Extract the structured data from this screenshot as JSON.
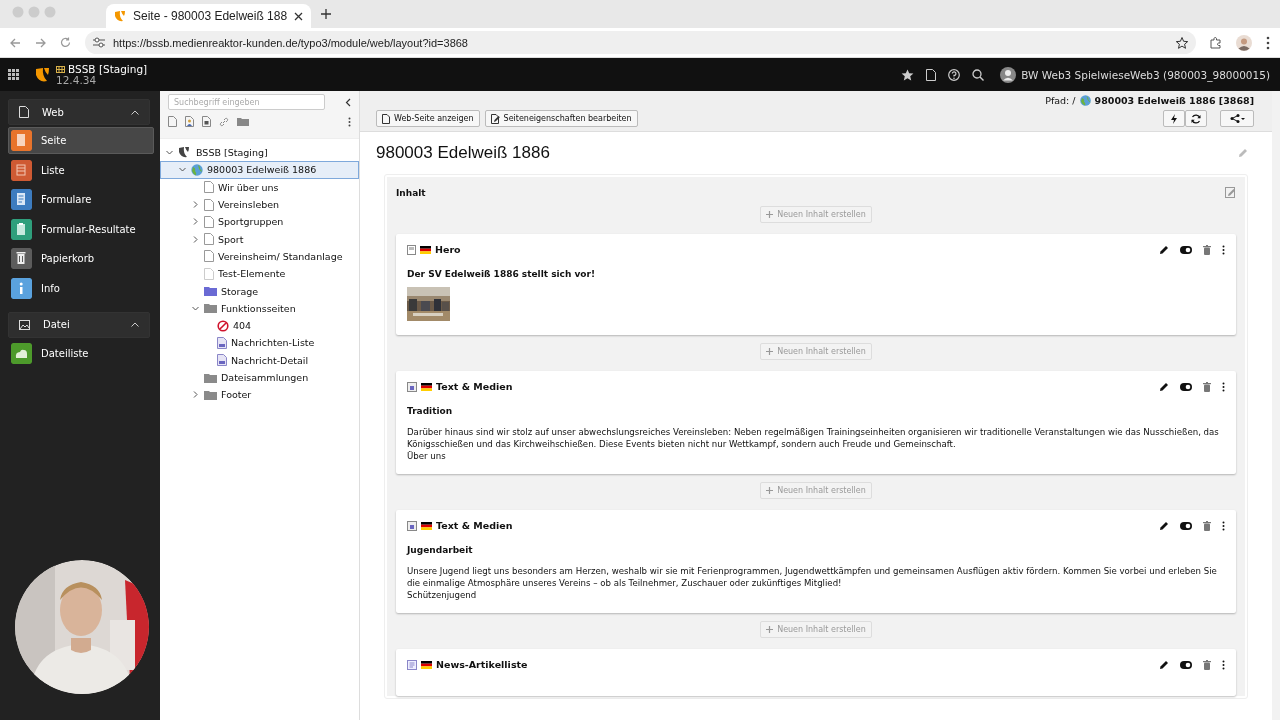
{
  "browser": {
    "tab_title": "Seite - 980003 Edelweiß 188",
    "url": "https://bssb.medienreaktor-kunden.de/typo3/module/web/layout?id=3868"
  },
  "topbar": {
    "site_name": "BSSB [Staging]",
    "version": "12.4.34",
    "user": "BW Web3 SpielwieseWeb3 (980003_98000015)"
  },
  "modules": [
    {
      "label": "Web",
      "expanded": true,
      "items": [
        {
          "label": "Seite",
          "color": "#e8742c",
          "selected": true
        },
        {
          "label": "Liste",
          "color": "#cf5a33",
          "selected": false
        },
        {
          "label": "Formulare",
          "color": "#3d7cbf",
          "selected": false
        },
        {
          "label": "Formular-Resultate",
          "color": "#2f9f7c",
          "selected": false
        },
        {
          "label": "Papierkorb",
          "color": "#5c5c5c",
          "selected": false
        },
        {
          "label": "Info",
          "color": "#5aa2de",
          "selected": false
        }
      ]
    },
    {
      "label": "Datei",
      "expanded": true,
      "items": [
        {
          "label": "Dateiliste",
          "color": "#4d9a2b",
          "selected": false
        }
      ]
    }
  ],
  "page_tree": {
    "search": {
      "placeholder": "Suchbegriff eingeben"
    },
    "nodes": [
      {
        "label": "BSSB [Staging]",
        "kind": "root",
        "expanded": true,
        "selected": false,
        "children": [
          {
            "label": "980003 Edelweiß 1886",
            "kind": "site",
            "expanded": true,
            "selected": true,
            "children": [
              {
                "label": "Wir über uns",
                "kind": "page",
                "selected": false
              },
              {
                "label": "Vereinsleben",
                "kind": "page",
                "expanded": false,
                "selected": false
              },
              {
                "label": "Sportgruppen",
                "kind": "page",
                "expanded": false,
                "selected": false
              },
              {
                "label": "Sport",
                "kind": "page",
                "expanded": false,
                "selected": false
              },
              {
                "label": "Vereinsheim/ Standanlage",
                "kind": "page",
                "selected": false
              },
              {
                "label": "Test-Elemente",
                "kind": "page_hidden",
                "selected": false
              },
              {
                "label": "Storage",
                "kind": "storage",
                "selected": false
              },
              {
                "label": "Funktionsseiten",
                "kind": "folder",
                "expanded": true,
                "selected": false,
                "children": [
                  {
                    "label": "404",
                    "kind": "error",
                    "selected": false
                  },
                  {
                    "label": "Nachrichten-Liste",
                    "kind": "plugin",
                    "selected": false
                  },
                  {
                    "label": "Nachricht-Detail",
                    "kind": "plugin",
                    "selected": false
                  }
                ]
              },
              {
                "label": "Dateisammlungen",
                "kind": "folder",
                "selected": false
              },
              {
                "label": "Footer",
                "kind": "folder",
                "expanded": false,
                "selected": false
              }
            ]
          }
        ]
      }
    ]
  },
  "doc_header": {
    "path_label": "Pfad: /",
    "path_title": "980003 Edelweiß 1886 [3868]",
    "buttons": [
      "Web-Seite anzeigen",
      "Seiteneigenschaften bearbeiten"
    ]
  },
  "page_title": "980003 Edelweiß 1886",
  "column": {
    "title": "Inhalt",
    "elements": [
      {
        "add_label": "Neuen Inhalt erstellen",
        "kind": "hero",
        "type_label": "Hero",
        "header": "Der SV Edelweiß 1886 stellt sich vor!"
      },
      {
        "add_label": "Neuen Inhalt erstellen",
        "kind": "textmedia",
        "type_label": "Text & Medien",
        "header": "Tradition",
        "bodytext": "Darüber hinaus sind wir stolz auf unser abwechslungsreiches Vereinsleben: Neben regelmäßigen Trainingseinheiten organisieren wir traditionelle Veranstaltungen wie das Nusschießen, das Königsschießen und das Kirchweihschießen. Diese Events bieten nicht nur Wettkampf, sondern auch Freude und Gemeinschaft.",
        "note": "Über uns"
      },
      {
        "add_label": "Neuen Inhalt erstellen",
        "kind": "textmedia",
        "type_label": "Text & Medien",
        "header": "Jugendarbeit",
        "bodytext": "Unsere Jugend liegt uns besonders am Herzen, weshalb wir sie mit Ferienprogrammen, Jugendwettkämpfen und gemeinsamen Ausflügen aktiv fördern. Kommen Sie vorbei und erleben Sie die einmalige Atmosphäre unseres Vereins – ob als Teilnehmer, Zuschauer oder zukünftiges Mitglied!",
        "note": "Schützenjugend"
      },
      {
        "add_label": "Neuen Inhalt erstellen",
        "kind": "news",
        "type_label": "News-Artikelliste"
      }
    ]
  }
}
